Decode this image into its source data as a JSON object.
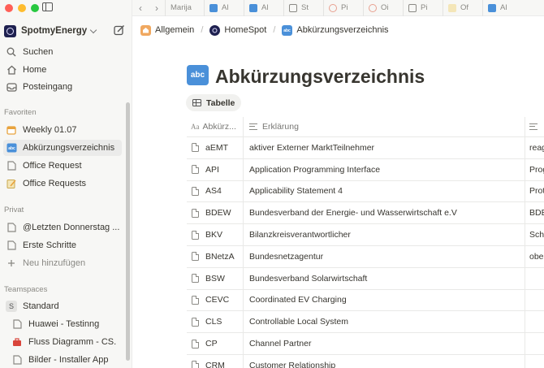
{
  "workspace": {
    "name": "SpotmyEnergy"
  },
  "nav": {
    "search": "Suchen",
    "home": "Home",
    "inbox": "Posteingang"
  },
  "favorites": {
    "title": "Favoriten",
    "items": [
      {
        "label": "Weekly 01.07"
      },
      {
        "label": "Abkürzungsverzeichnis"
      },
      {
        "label": "Office Request"
      },
      {
        "label": "Office Requests"
      }
    ]
  },
  "private": {
    "title": "Privat",
    "items": [
      {
        "label": "@Letzten Donnerstag ..."
      },
      {
        "label": "Erste Schritte"
      }
    ],
    "add_label": "Neu hinzufügen"
  },
  "teamspaces": {
    "title": "Teamspaces",
    "badge": "S",
    "items": [
      {
        "label": "Standard"
      },
      {
        "label": "Huawei - Testinng"
      },
      {
        "label": "Fluss Diagramm - CS."
      },
      {
        "label": "Bilder - Installer App"
      }
    ]
  },
  "tabs": [
    {
      "label": "Marija"
    },
    {
      "label": "Al"
    },
    {
      "label": "Al"
    },
    {
      "label": "St"
    },
    {
      "label": "Pi"
    },
    {
      "label": "Oi"
    },
    {
      "label": "Pi"
    },
    {
      "label": "Of"
    },
    {
      "label": "Al"
    }
  ],
  "breadcrumbs": {
    "items": [
      {
        "label": "Allgemein"
      },
      {
        "label": "HomeSpot"
      },
      {
        "label": "Abkürzungsverzeichnis"
      }
    ],
    "separator": "/"
  },
  "page": {
    "icon_text": "abc",
    "title": "Abkürzungsverzeichnis",
    "view_label": "Tabelle"
  },
  "table": {
    "columns": {
      "key": "Abkürz...",
      "desc": "Erklärung",
      "extra": ""
    },
    "rows": [
      {
        "key": "aEMT",
        "desc": "aktiver Externer MarktTeilnehmer",
        "extra": "reag"
      },
      {
        "key": "API",
        "desc": "Application Programming Interface",
        "extra": "Prog"
      },
      {
        "key": "AS4",
        "desc": "Applicability Statement 4",
        "extra": "Prot"
      },
      {
        "key": "BDEW",
        "desc": "Bundesverband der Energie- und Wasserwirtschaft e.V",
        "extra": "BDE"
      },
      {
        "key": "BKV",
        "desc": "Bilanzkreisverantwortlicher",
        "extra": "Sch"
      },
      {
        "key": "BNetzA",
        "desc": "Bundesnetzagentur",
        "extra": "obe"
      },
      {
        "key": "BSW",
        "desc": "Bundesverband Solarwirtschaft",
        "extra": ""
      },
      {
        "key": "CEVC",
        "desc": "Coordinated EV Charging",
        "extra": ""
      },
      {
        "key": "CLS",
        "desc": "Controllable Local System",
        "extra": ""
      },
      {
        "key": "CP",
        "desc": "Channel Partner",
        "extra": ""
      },
      {
        "key": "CRM",
        "desc": "Customer Relationship",
        "extra": ""
      }
    ]
  }
}
